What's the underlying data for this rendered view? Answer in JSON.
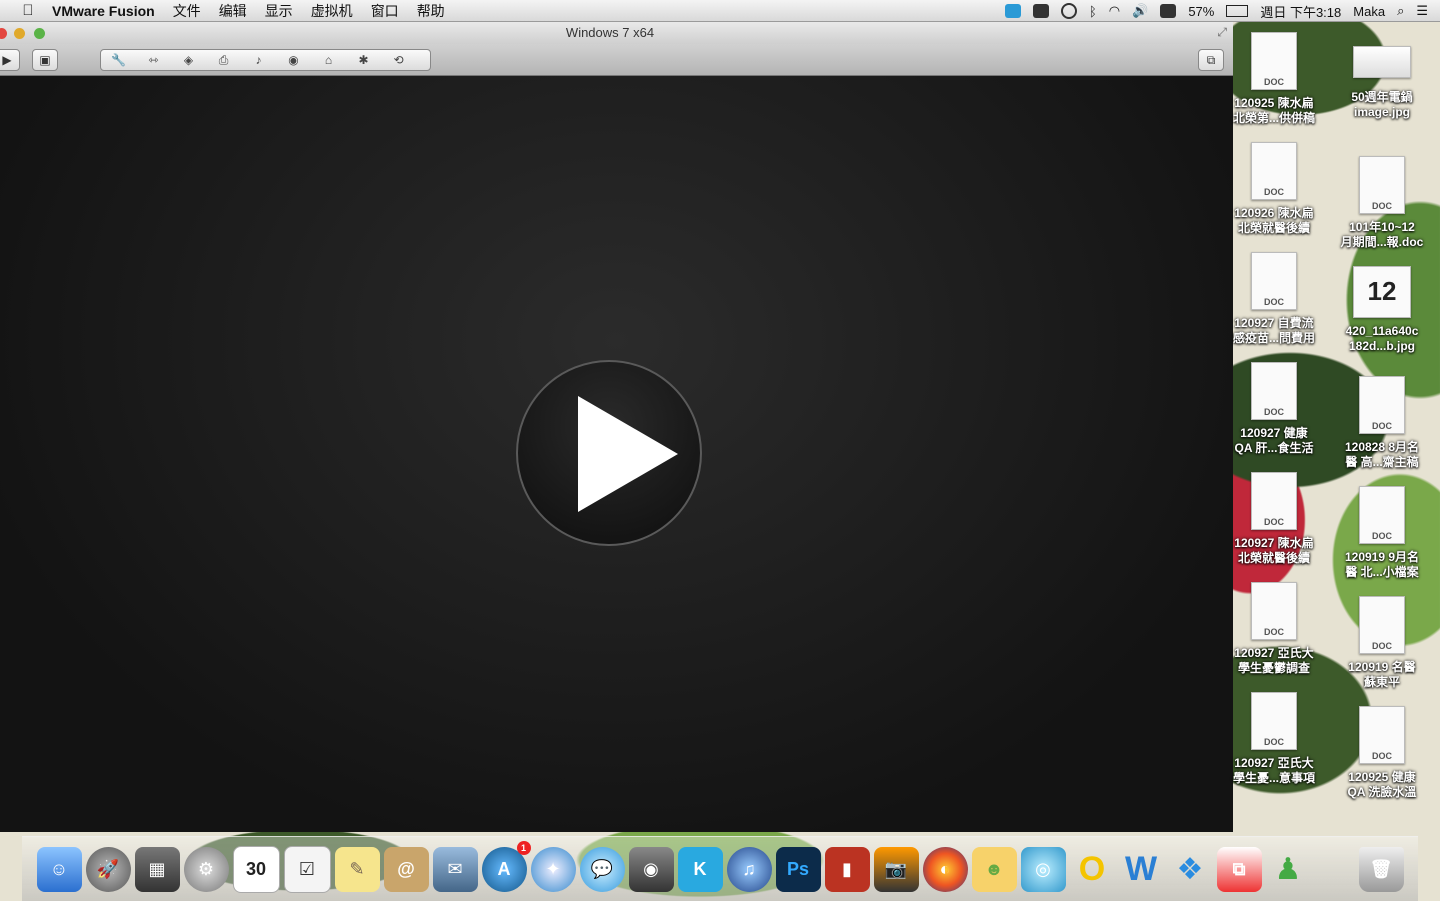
{
  "menubar": {
    "app": "VMware Fusion",
    "items": [
      "文件",
      "编辑",
      "显示",
      "虚拟机",
      "窗口",
      "帮助"
    ],
    "battery": "57%",
    "clock": "週日 下午3:18",
    "user": "Maka"
  },
  "window": {
    "title": "Windows 7 x64"
  },
  "toolbar": {
    "icons": [
      "wrench-icon",
      "network-icon",
      "disk-icon",
      "printer-icon",
      "speaker-icon",
      "camera-icon",
      "usb-icon",
      "bluetooth-icon",
      "sync-icon"
    ]
  },
  "desktop": {
    "col1": [
      {
        "name1": "120925 陳水扁",
        "name2": "北榮第...供併稿"
      },
      {
        "name1": "120926 陳水扁",
        "name2": "北榮就醫後續"
      },
      {
        "name1": "120927 自費流",
        "name2": "感疫苗...問費用"
      },
      {
        "name1": "120927 健康",
        "name2": "QA 肝...食生活"
      },
      {
        "name1": "120927 陳水扁",
        "name2": "北榮就醫後續"
      },
      {
        "name1": "120927 亞氏大",
        "name2": "學生憂鬱調查"
      },
      {
        "name1": "120927 亞氏大",
        "name2": "學生憂...意事項"
      }
    ],
    "col2": [
      {
        "name1": "50週年電鍋",
        "name2": "image.jpg",
        "kind": "image"
      },
      {
        "name1": "101年10~12",
        "name2": "月期間...報.doc",
        "kind": "doc"
      },
      {
        "name1": "420_11a640c",
        "name2": "182d...b.jpg",
        "kind": "calendar",
        "num": "12"
      },
      {
        "name1": "120828 8月名",
        "name2": "醫 高...齋主稿",
        "kind": "doc"
      },
      {
        "name1": "120919 9月名",
        "name2": "醫 北...小檔案",
        "kind": "doc"
      },
      {
        "name1": "120919 名醫",
        "name2": "蘇東平",
        "kind": "doc"
      },
      {
        "name1": "120925 健康",
        "name2": "QA 洗臉水溫",
        "kind": "doc"
      }
    ],
    "doc_tag": "DOC"
  },
  "dock": {
    "calendar_day": "30",
    "appstore_badge": "1",
    "ps_label": "Ps"
  }
}
